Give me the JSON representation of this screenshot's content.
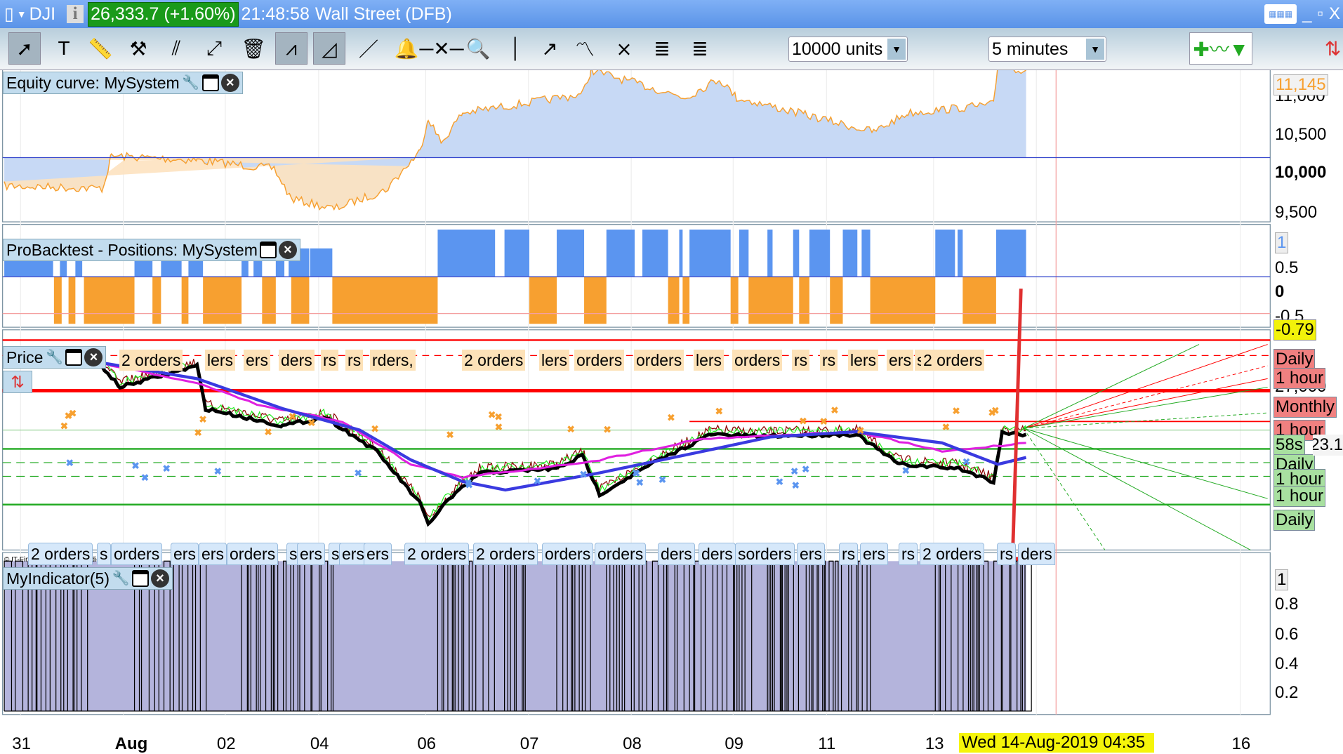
{
  "title_bar": {
    "symbol": "DJI",
    "price_change": "26,333.7 (+1.60%)",
    "time": "21:48:58",
    "instrument": "Wall Street (DFB)",
    "min": "_",
    "restore": "▫",
    "close": "X"
  },
  "toolbar": {
    "icons": [
      "cursor-icon",
      "text-icon",
      "ruler-icon",
      "tools-icon",
      "parallel-lines-icon",
      "segment-icon",
      "trash-icon",
      "channel-icon",
      "triangle-icon",
      "line-icon",
      "alert-bell-icon",
      "horizontal-line-icon",
      "zoom-icon",
      "vertical-line-icon",
      "ray-icon",
      "trend-icon",
      "fork-icon",
      "fibonacci-icon",
      "fibonacci-fan-icon"
    ],
    "units": "10000 units",
    "timeframe": "5 minutes"
  },
  "panels": {
    "equity": {
      "label": "Equity curve: MySystem",
      "ticks": [
        "11,000",
        "10,500",
        "10,000",
        "9,500"
      ],
      "current": "11,145"
    },
    "positions": {
      "label": "ProBacktest - Positions: MySystem",
      "ticks": [
        "1",
        "0.5",
        "0",
        "-0.5"
      ],
      "current": "-0.79"
    },
    "price": {
      "label": "Price",
      "ticks": [
        "27,000"
      ],
      "tags": [
        {
          "t": "Daily",
          "c": "red"
        },
        {
          "t": "1 hour",
          "c": "red"
        },
        {
          "t": "Monthly",
          "c": "red"
        },
        {
          "t": "1 hour",
          "c": "red"
        },
        {
          "t": "58s",
          "c": "green"
        },
        {
          "t": "Daily",
          "c": "green"
        },
        {
          "t": "1 hour",
          "c": "green"
        },
        {
          "t": "1 hour",
          "c": "green"
        },
        {
          "t": "Daily",
          "c": "green"
        }
      ],
      "current": "26,323.1",
      "top_orders": [
        "2 orders",
        "lers",
        "ers",
        "ders",
        "rs",
        "rs",
        "rders,",
        "2 orders",
        "lers",
        "orders",
        "orders",
        "lers",
        "orders",
        "rs",
        "rs",
        "lers",
        "ers",
        "s",
        "2 orders"
      ],
      "bottom_orders": [
        "2 orders",
        "s",
        "orders",
        "ers",
        "ers",
        "orders",
        "s",
        "ers",
        "s",
        "ers",
        "ers",
        "2 orders",
        "2 orders",
        "orders",
        "orders",
        "ders",
        "ders",
        "sorders",
        "ers",
        "rs",
        "ers",
        "rs",
        "2 orders",
        "rs",
        "ders"
      ],
      "copyright": "© IT-Finance.com Data is indicative"
    },
    "indicator": {
      "label": "MyIndicator(5)",
      "ticks": [
        "1",
        "0.8",
        "0.6",
        "0.4",
        "0.2"
      ]
    }
  },
  "x_axis": {
    "labels": [
      "31",
      "Aug",
      "02",
      "04",
      "06",
      "07",
      "08",
      "09",
      "11",
      "13",
      "16"
    ],
    "cursor": "Wed 14-Aug-2019 04:35"
  },
  "colors": {
    "equity_fill": "#c7d9f5",
    "equity_loss": "#fde2c0",
    "long": "#5b95f0",
    "short": "#f7a030",
    "indicator": "#b4b4dc"
  }
}
